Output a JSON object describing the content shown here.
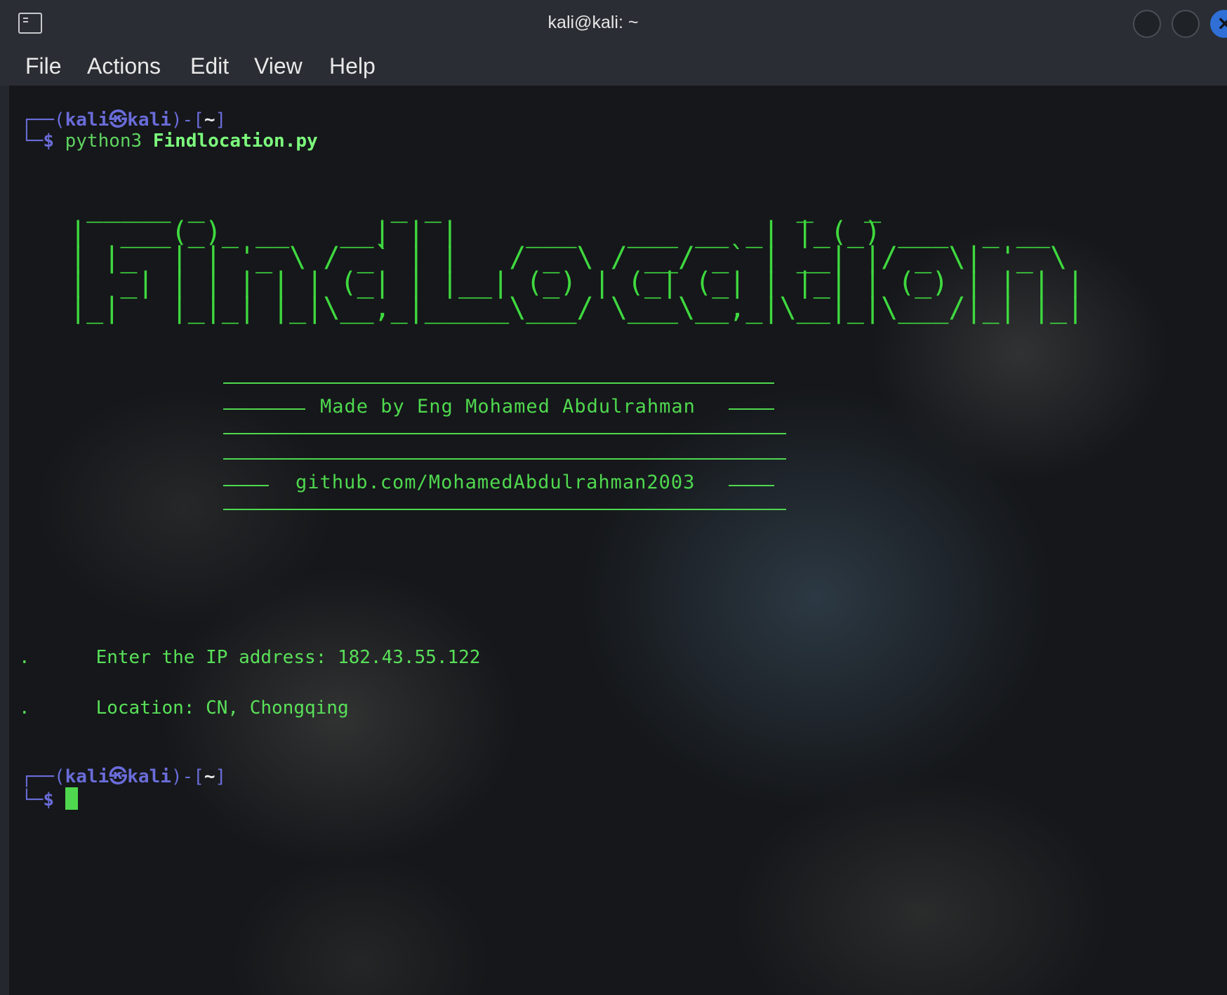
{
  "window": {
    "title": "kali@kali: ~"
  },
  "menu": {
    "items": [
      "File",
      "Actions",
      "Edit",
      "View",
      "Help"
    ]
  },
  "prompt": {
    "user": "kali",
    "host": "kali",
    "at_symbol": "㉿",
    "path": "~",
    "dollar": "$"
  },
  "command": {
    "program": "python3",
    "argument": "Findlocation.py"
  },
  "banner": {
    "ascii_art": "  _____ _           _ _                     _   _             \n |  ___(_)_ __   __| | |    ___   ___ __ _| |_(_) ___  _ __  \n | |_  | | '_ \\ / _` | |   / _ \\ / __/ _` | __| |/ _ \\| '_ \\ \n |  _| | | | | | (_| | |__| (_) | (_| (_| | |_| | (_) | | | |\n |_|   |_|_| |_|\\__,_|_____\\___/ \\___\\__,_|\\__|_|\\___/|_| |_|",
    "made_by": "Made by Eng Mohamed Abdulrahman",
    "github": "github.com/MohamedAbdulrahman2003"
  },
  "output": {
    "bullet": ".",
    "ip_prompt": "Enter the IP address: 182.43.55.122",
    "location": "Location: CN, Chongqing"
  }
}
